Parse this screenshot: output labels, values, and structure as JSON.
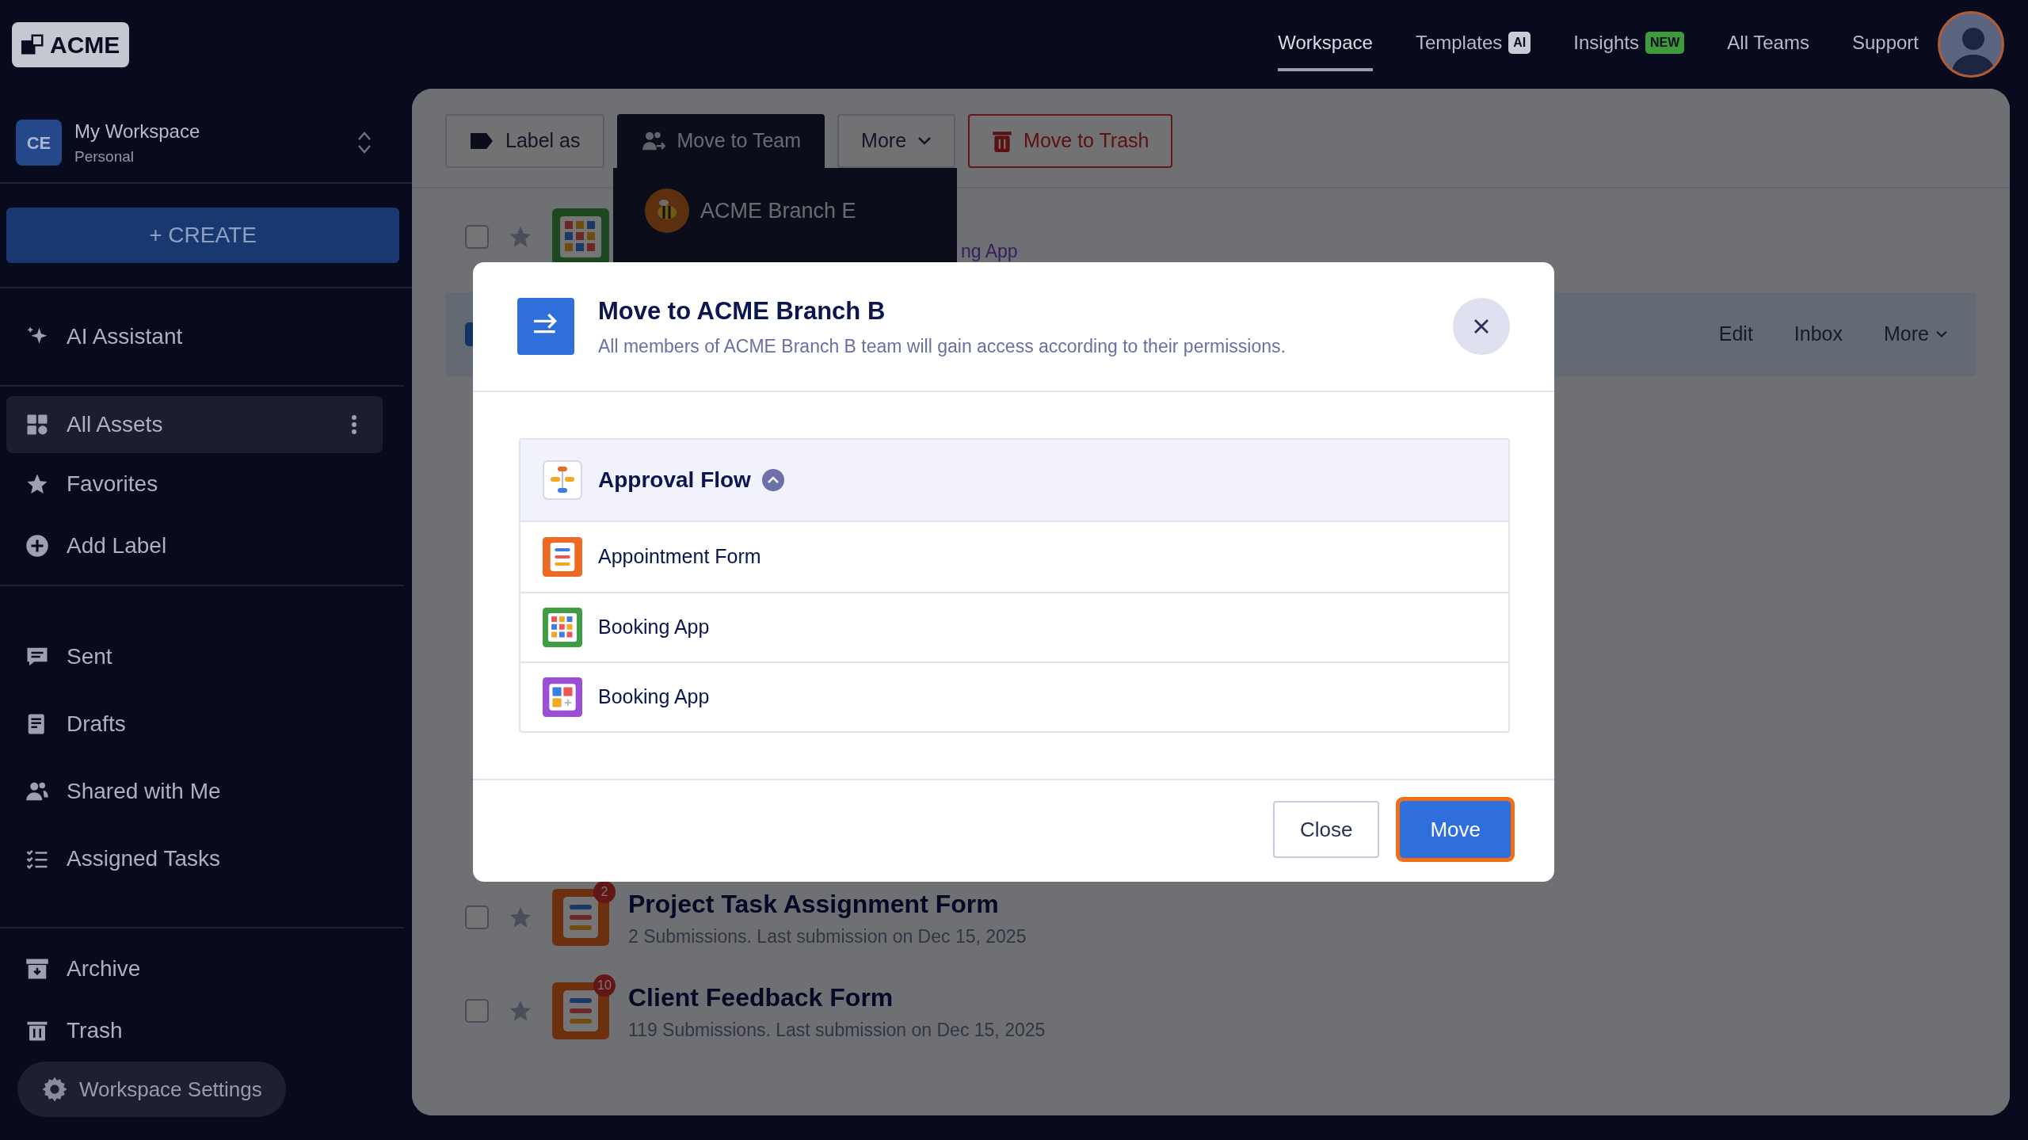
{
  "topbar": {
    "logo": "ACME",
    "nav": [
      {
        "label": "Workspace",
        "selected": true
      },
      {
        "label": "Templates",
        "selected": false,
        "badge": {
          "text": "AI",
          "color": "#c9ccd6"
        }
      },
      {
        "label": "Insights",
        "selected": false,
        "badge": {
          "text": "NEW",
          "color": "#3f9a3b"
        }
      },
      {
        "label": "All Teams",
        "selected": false
      },
      {
        "label": "Support",
        "selected": false
      }
    ]
  },
  "workspace": {
    "initials": "CE",
    "name": "My Workspace",
    "type": "Personal"
  },
  "create_button": "+ CREATE",
  "sidebar": {
    "groups": [
      [
        {
          "label": "AI Assistant",
          "selected": false
        }
      ],
      [
        {
          "label": "All Assets",
          "selected": true
        },
        {
          "label": "Favorites",
          "selected": false
        },
        {
          "label": "Add Label",
          "selected": false
        }
      ],
      [
        {
          "label": "Sent",
          "selected": false
        },
        {
          "label": "Drafts",
          "selected": false
        },
        {
          "label": "Shared with Me",
          "selected": false
        },
        {
          "label": "Assigned Tasks",
          "selected": false
        }
      ],
      [
        {
          "label": "Archive",
          "selected": false
        },
        {
          "label": "Trash",
          "selected": false
        }
      ]
    ],
    "settings": "Workspace Settings"
  },
  "toolbar": [
    {
      "label": "Label as",
      "kind": "default"
    },
    {
      "label": "Move to Team",
      "kind": "open"
    },
    {
      "label": "More",
      "kind": "dropdown"
    },
    {
      "label": "Move to Trash",
      "kind": "danger"
    }
  ],
  "team_menu": {
    "items": [
      {
        "label": "ACME Branch E"
      }
    ]
  },
  "rows": [
    {
      "kind": "app",
      "checked": false,
      "subtitle": "ng App"
    },
    {
      "kind": "actions",
      "checked": true,
      "actions": [
        "Edit",
        "Inbox",
        "More"
      ]
    },
    {
      "kind": "form",
      "checked": false,
      "title": "Project Task Assignment Form",
      "subtitle": "2 Submissions. Last submission on Dec 15, 2025",
      "count": "2"
    },
    {
      "kind": "form",
      "checked": false,
      "title": "Client Feedback Form",
      "subtitle": "119 Submissions. Last submission on Dec 15, 2025",
      "count": "10"
    }
  ],
  "modal": {
    "title": "Move to ACME Branch B",
    "description": "All members of ACME Branch B team will gain access according to their permissions.",
    "group": {
      "title": "Approval Flow",
      "expanded": true,
      "items": [
        {
          "label": "Appointment Form",
          "kind": "form"
        },
        {
          "label": "Booking App",
          "kind": "app"
        },
        {
          "label": "Booking App",
          "kind": "app-purple"
        }
      ]
    },
    "buttons": [
      {
        "label": "Close",
        "kind": "secondary",
        "focused": false
      },
      {
        "label": "Move",
        "kind": "primary",
        "focused": true
      }
    ]
  }
}
